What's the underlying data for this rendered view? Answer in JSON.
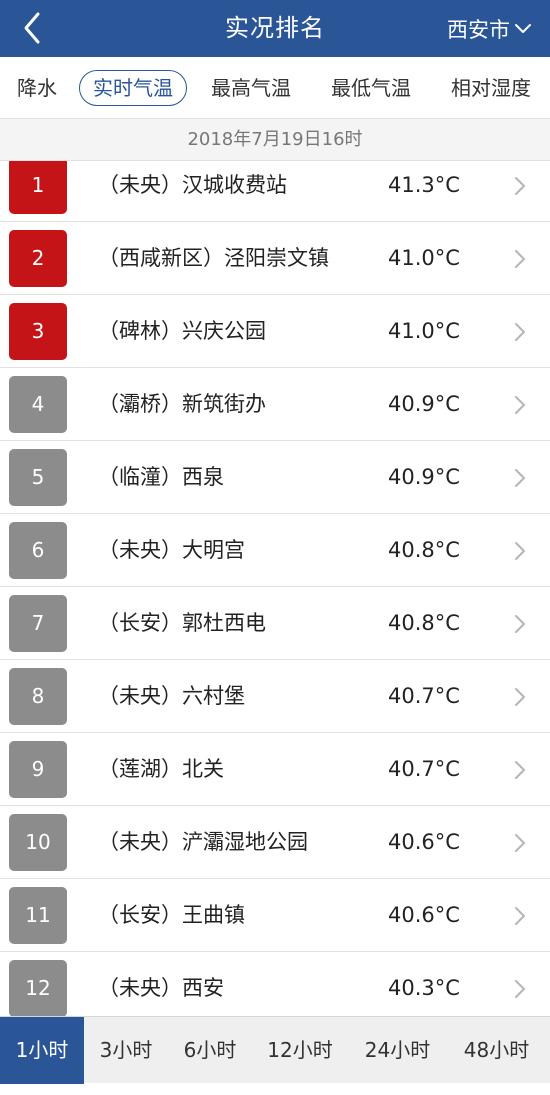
{
  "header": {
    "title": "实况排名",
    "city": "西安市",
    "back_icon": "back-arrow-icon",
    "city_icon": "chevron-down-icon",
    "bg_color": "#2a5596"
  },
  "tabs": [
    {
      "label": "降水",
      "active": false
    },
    {
      "label": "实时气温",
      "active": true
    },
    {
      "label": "最高气温",
      "active": false
    },
    {
      "label": "最低气温",
      "active": false
    },
    {
      "label": "相对湿度",
      "active": false
    }
  ],
  "date": "2018年7月19日16时",
  "rows": [
    {
      "rank": "1",
      "station": "（未央）汉城收费站",
      "temp": "41.3°C",
      "top": true
    },
    {
      "rank": "2",
      "station": "（西咸新区）泾阳崇文镇",
      "temp": "41.0°C",
      "top": true
    },
    {
      "rank": "3",
      "station": "（碑林）兴庆公园",
      "temp": "41.0°C",
      "top": true
    },
    {
      "rank": "4",
      "station": "（灞桥）新筑街办",
      "temp": "40.9°C",
      "top": false
    },
    {
      "rank": "5",
      "station": "（临潼）西泉",
      "temp": "40.9°C",
      "top": false
    },
    {
      "rank": "6",
      "station": "（未央）大明宫",
      "temp": "40.8°C",
      "top": false
    },
    {
      "rank": "7",
      "station": "（长安）郭杜西电",
      "temp": "40.8°C",
      "top": false
    },
    {
      "rank": "8",
      "station": "（未央）六村堡",
      "temp": "40.7°C",
      "top": false
    },
    {
      "rank": "9",
      "station": "（莲湖）北关",
      "temp": "40.7°C",
      "top": false
    },
    {
      "rank": "10",
      "station": "（未央）浐灞湿地公园",
      "temp": "40.6°C",
      "top": false
    },
    {
      "rank": "11",
      "station": "（长安）王曲镇",
      "temp": "40.6°C",
      "top": false
    },
    {
      "rank": "12",
      "station": "（未央）西安",
      "temp": "40.3°C",
      "top": false
    }
  ],
  "bottom_tabs": [
    {
      "label": "1小时",
      "active": true
    },
    {
      "label": "3小时",
      "active": false
    },
    {
      "label": "6小时",
      "active": false
    },
    {
      "label": "12小时",
      "active": false
    },
    {
      "label": "24小时",
      "active": false
    },
    {
      "label": "48小时",
      "active": false
    }
  ],
  "colors": {
    "rank_top": "#c41418",
    "rank_rest": "#8c8c8c",
    "accent": "#2a5596"
  }
}
